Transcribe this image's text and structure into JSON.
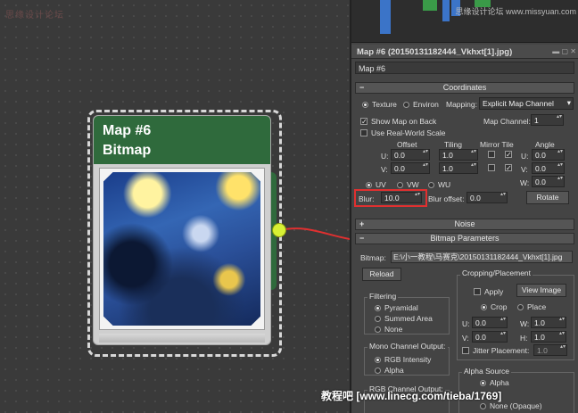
{
  "schematic": {
    "watermark": "思缘设计论坛",
    "node": {
      "title": "Map #6",
      "subtitle": "Bitmap",
      "accent": "#2f6a3c",
      "socket_color": "#d7f034",
      "wire_color": "#e03030"
    }
  },
  "panel": {
    "watermark_top": "思缘设计论坛 www.missyuan.com",
    "title": "Map #6 (20150131182444_Vkhxt[1].jpg)",
    "map_name": "Map #6",
    "coordinates": {
      "header": "Coordinates",
      "texture_label": "Texture",
      "environ_label": "Environ",
      "mapping_label": "Mapping:",
      "mapping_value": "Explicit Map Channel",
      "show_map_label": "Show Map on Back",
      "map_channel_label": "Map Channel:",
      "map_channel_value": "1",
      "real_world_label": "Use Real-World Scale",
      "offset_label": "Offset",
      "tiling_label": "Tiling",
      "mirror_tile_label": "Mirror Tile",
      "angle_label": "Angle",
      "u_label": "U:",
      "v_label": "V:",
      "w_label": "W:",
      "u_offset": "0.0",
      "v_offset": "0.0",
      "u_tiling": "1.0",
      "v_tiling": "1.0",
      "u_angle": "0.0",
      "v_angle": "0.0",
      "w_angle": "0.0",
      "uv_label": "UV",
      "vw_label": "VW",
      "wu_label": "WU",
      "blur_label": "Blur:",
      "blur_value": "10.0",
      "blur_offset_label": "Blur offset:",
      "blur_offset_value": "0.0",
      "rotate_label": "Rotate"
    },
    "noise": {
      "header": "Noise"
    },
    "bitmap_params": {
      "header": "Bitmap Parameters",
      "bitmap_label": "Bitmap:",
      "bitmap_path": "E:\\小一教程\\马赛克\\20150131182444_Vkhxt[1].jpg",
      "reload_label": "Reload",
      "cropping_title": "Cropping/Placement",
      "apply_label": "Apply",
      "view_image_label": "View Image",
      "crop_label": "Crop",
      "place_label": "Place",
      "u_label": "U:",
      "v_label": "V:",
      "w_label": "W:",
      "h_label": "H:",
      "u_value": "0.0",
      "v_value": "0.0",
      "w_value": "1.0",
      "h_value": "1.0",
      "jitter_label": "Jitter Placement:",
      "jitter_value": "1.0",
      "filtering_title": "Filtering",
      "pyramidal_label": "Pyramidal",
      "summed_area_label": "Summed Area",
      "none_label": "None",
      "mono_title": "Mono Channel Output:",
      "rgb_intensity_label": "RGB Intensity",
      "alpha_label": "Alpha",
      "rgb_channel_title": "RGB Channel Output:",
      "alpha_source_title": "Alpha Source",
      "alpha_source_alpha": "Alpha",
      "alpha_source_none": "None (Opaque)"
    }
  },
  "watermark_bottom": "教程吧 [www.linecg.com/tieba/1769]"
}
